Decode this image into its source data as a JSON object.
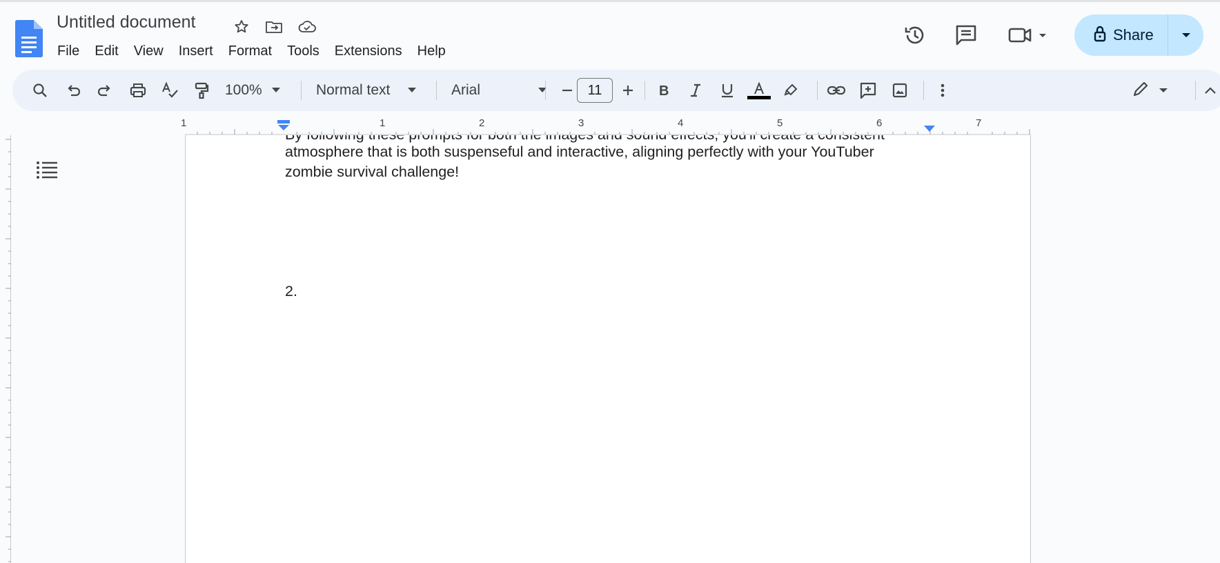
{
  "app": {
    "doc_title": "Untitled document",
    "menu": [
      "File",
      "Edit",
      "View",
      "Insert",
      "Format",
      "Tools",
      "Extensions",
      "Help"
    ],
    "share_label": "Share"
  },
  "toolbar": {
    "zoom": "100%",
    "style": "Normal text",
    "font": "Arial",
    "font_size": "11",
    "text_color": "#000000"
  },
  "ruler": {
    "numbers": [
      "1",
      "1",
      "2",
      "3",
      "4",
      "5",
      "6",
      "7"
    ]
  },
  "document": {
    "lines": [
      "By following these prompts for both the images and sound effects, you'll create a consistent",
      "atmosphere that is both suspenseful and interactive, aligning perfectly with your YouTuber",
      "zombie survival challenge!",
      "2."
    ]
  },
  "colors": {
    "accent": "#1a73e8",
    "share_bg": "#c2e7ff",
    "toolbar_bg": "#edf2fa"
  }
}
